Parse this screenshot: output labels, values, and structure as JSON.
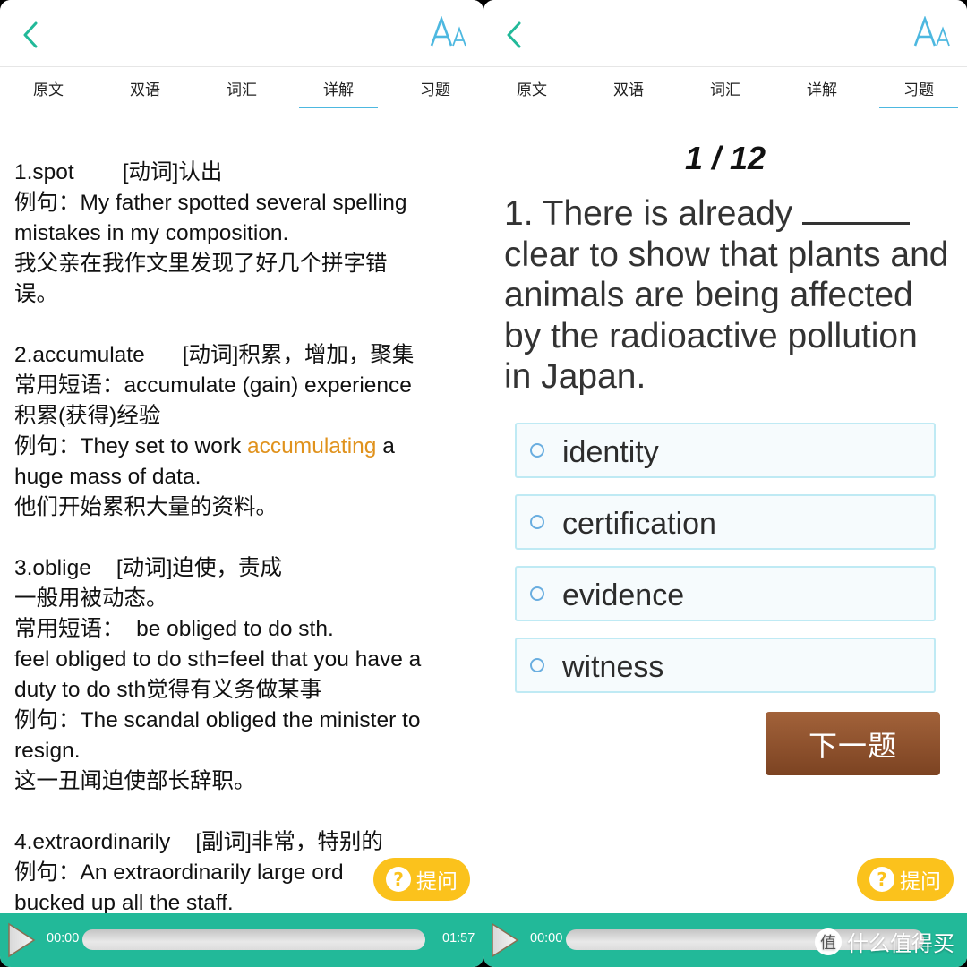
{
  "tabs": [
    "原文",
    "双语",
    "词汇",
    "详解",
    "习题"
  ],
  "left": {
    "active_tab": "详解",
    "entries": [
      {
        "head_word": "1.spot",
        "head_pos": "[动词]认出",
        "lines": [
          "例句：My father spotted several spelling",
          "mistakes in my composition.",
          "我父亲在我作文里发现了好几个拼字错",
          "误。"
        ]
      },
      {
        "head_word": "2.accumulate",
        "head_pos": "[动词]积累，增加，聚集",
        "line1": "常用短语：accumulate (gain) experience",
        "line2": "积累(获得)经验",
        "example_pre": "例句：They set to work ",
        "example_highlight": "accumulating",
        "example_post": " a",
        "line4": "huge mass of data.",
        "line5": "他们开始累积大量的资料。"
      },
      {
        "head_word": "3.oblige",
        "head_pos": "[动词]迫使，责成",
        "lines": [
          "一般用被动态。",
          "常用短语：  be obliged to do sth.",
          "feel obliged to do sth=feel that you have a",
          "duty to do sth觉得有义务做某事",
          "例句：The scandal obliged the minister to",
          "resign.",
          "这一丑闻迫使部长辞职。"
        ]
      },
      {
        "head_word": "4.extraordinarily",
        "head_pos": "[副词]非常，特别的",
        "lines": [
          "例句：An extraordinarily large ord",
          "bucked up all the staff."
        ]
      }
    ],
    "ask_button": "提问",
    "player": {
      "current": "00:00",
      "total": "01:57",
      "progress": 0
    }
  },
  "right": {
    "active_tab": "习题",
    "counter": "1 / 12",
    "question_pre": "1. There is already ",
    "question_post": " clear to show that plants and animals are being affected by the radioactive pollution in Japan.",
    "options": [
      "identity",
      "certification",
      "evidence",
      "witness"
    ],
    "next_button": "下一题",
    "ask_button": "提问",
    "player": {
      "current": "00:00",
      "progress": 0
    },
    "watermark": {
      "icon": "值",
      "text": "什么值得买"
    }
  },
  "colors": {
    "accent_green": "#22b999",
    "tab_underline": "#4db8e0",
    "highlight": "#e0921d",
    "ask_yellow": "#fbc21c",
    "next_brown": "#8e5230"
  }
}
